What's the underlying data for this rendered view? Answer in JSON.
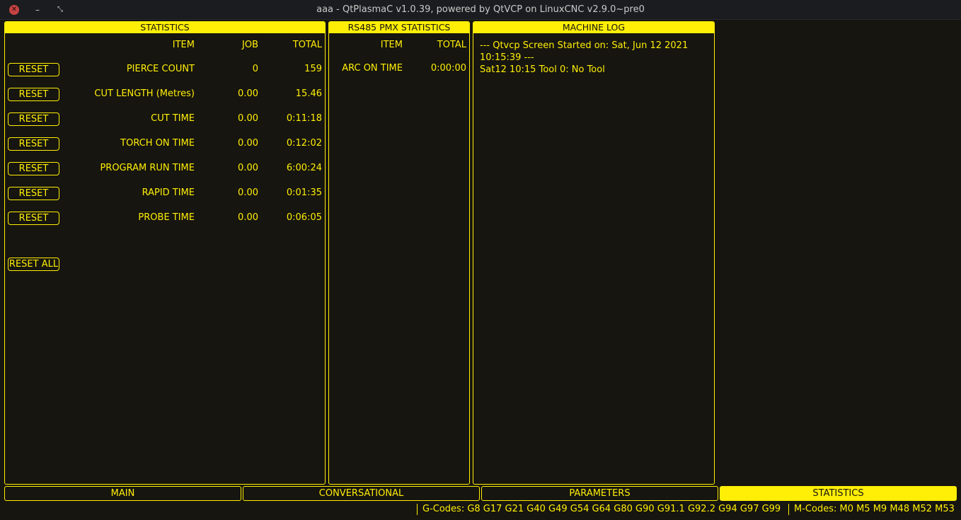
{
  "window": {
    "title": "aaa - QtPlasmaC v1.0.39, powered by QtVCP on LinuxCNC v2.9.0~pre0",
    "close_glyph": "✕",
    "minimize_glyph": "–",
    "maximize_glyph": "⤡"
  },
  "statistics": {
    "header": "STATISTICS",
    "col_item": "ITEM",
    "col_job": "JOB",
    "col_total": "TOTAL",
    "reset_label": "RESET",
    "reset_all_label": "RESET ALL",
    "rows": [
      {
        "item": "PIERCE COUNT",
        "job": "0",
        "total": "159"
      },
      {
        "item": "CUT LENGTH (Metres)",
        "job": "0.00",
        "total": "15.46"
      },
      {
        "item": "CUT TIME",
        "job": "0.00",
        "total": "0:11:18"
      },
      {
        "item": "TORCH ON TIME",
        "job": "0.00",
        "total": "0:12:02"
      },
      {
        "item": "PROGRAM RUN TIME",
        "job": "0.00",
        "total": "6:00:24"
      },
      {
        "item": "RAPID TIME",
        "job": "0.00",
        "total": "0:01:35"
      },
      {
        "item": "PROBE TIME",
        "job": "0.00",
        "total": "0:06:05"
      }
    ]
  },
  "pmx": {
    "header": "RS485 PMX STATISTICS",
    "col_item": "ITEM",
    "col_total": "TOTAL",
    "rows": [
      {
        "item": "ARC ON TIME",
        "total": "0:00:00"
      }
    ]
  },
  "machine_log": {
    "header": "MACHINE LOG",
    "lines": [
      "--- Qtvcp Screen Started on: Sat, Jun 12 2021",
      "10:15:39 ---",
      "Sat12 10:15 Tool 0: No Tool"
    ]
  },
  "tabs": [
    {
      "label": "MAIN",
      "active": false
    },
    {
      "label": "CONVERSATIONAL",
      "active": false
    },
    {
      "label": "PARAMETERS",
      "active": false
    },
    {
      "label": "STATISTICS",
      "active": true
    }
  ],
  "status": {
    "gcodes": "G-Codes: G8 G17 G21 G40 G49 G54 G64 G80 G90 G91.1 G92.2 G94 G97 G99",
    "mcodes": "M-Codes: M0 M5 M9 M48 M52 M53"
  }
}
